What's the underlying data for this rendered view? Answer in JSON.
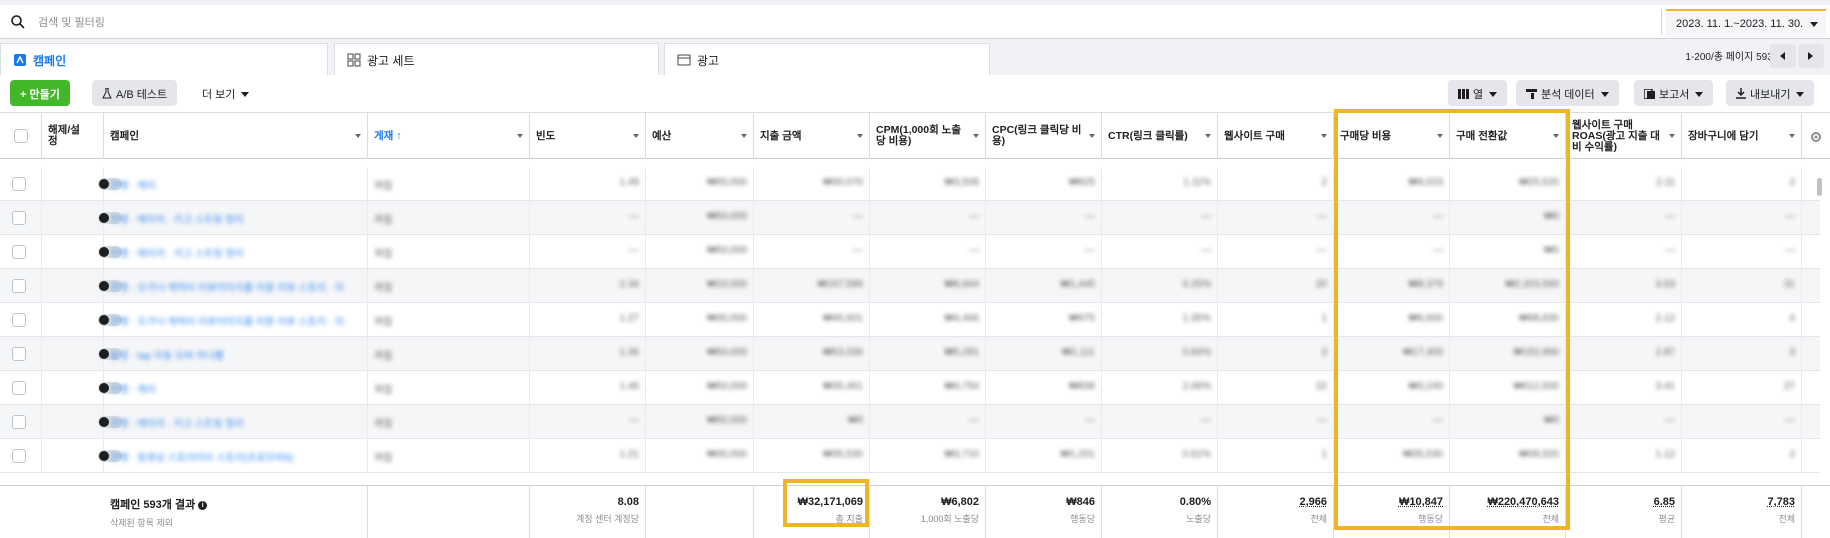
{
  "search": {
    "placeholder": "검색 및 필터링"
  },
  "date_range": "2023. 11. 1.~2023. 11. 30.",
  "tabs": [
    {
      "label": "캠페인"
    },
    {
      "label": "광고 세트"
    },
    {
      "label": "광고"
    }
  ],
  "pager": {
    "text": "1-200/총 페이지 593개"
  },
  "toolbar": {
    "create_label": "+ 만들기",
    "ab_test_label": "A/B 테스트",
    "more_label": "더 보기",
    "columns_label": "열",
    "breakdown_label": "분석 데이터",
    "reports_label": "보고서",
    "export_label": "내보내기"
  },
  "columns": [
    "해제/설정",
    "캠페인",
    "게재 ↑",
    "빈도",
    "예산",
    "지출 금액",
    "CPM(1,000회 노출당 비용)",
    "CPC(링크 클릭당 비용)",
    "CTR(링크 클릭률)",
    "웹사이트 구매",
    "구매당 비용",
    "구매 전환값",
    "웹사이트 구매 ROAS(광고 지출 대비 수익률)",
    "장바구니에 담기"
  ],
  "rows": [
    {
      "name": "진행 · 캐리",
      "delivery": "꺼짐",
      "freq": "1.49",
      "budget": "₩50,000",
      "spend": "₩30,070",
      "cpm": "₩3,508",
      "cpc": "₩825",
      "ctr": "1.11%",
      "purchases": "2",
      "cpp": "₩9,023",
      "value": "₩25,520",
      "roas": "2.11",
      "cart": "2"
    },
    {
      "name": "진행 · 메이저 · 키고 스트링 정리",
      "delivery": "꺼짐",
      "freq": "—",
      "budget": "₩50,000",
      "spend": "—",
      "cpm": "—",
      "cpc": "—",
      "ctr": "—",
      "purchases": "—",
      "cpp": "—",
      "value": "₩0",
      "roas": "—",
      "cart": "—"
    },
    {
      "name": "진행 · 메이저 · 키고 스트링 정리",
      "delivery": "꺼짐",
      "freq": "—",
      "budget": "₩50,000",
      "spend": "—",
      "cpm": "—",
      "cpc": "—",
      "ctr": "—",
      "purchases": "—",
      "cpp": "—",
      "value": "₩0",
      "roas": "—",
      "cart": "—"
    },
    {
      "name": "진행 · 오가닉 캐릭터 리뷰이미지를 이용 리뷰 스토리 · 이",
      "delivery": "꺼짐",
      "freq": "2.34",
      "budget": "₩10,000",
      "spend": "₩167,586",
      "cpm": "₩6,664",
      "cpc": "₩1,445",
      "ctr": "0.25%",
      "purchases": "20",
      "cpp": "₩8,379",
      "value": "₩2,203,560",
      "roas": "3.63",
      "cart": "31"
    },
    {
      "name": "진행 · 오가닉 캐릭터 리뷰이미지를 이용 리뷰 스토리 · 이",
      "delivery": "꺼짐",
      "freq": "1.27",
      "budget": "₩30,000",
      "spend": "₩46,601",
      "cpm": "₩4,466",
      "cpc": "₩675",
      "ctr": "1.35%",
      "purchases": "1",
      "cpp": "₩6,600",
      "value": "₩98,830",
      "roas": "2.12",
      "cart": "4"
    },
    {
      "name": "동영 · tap 이동 오바 하나쁨",
      "delivery": "꺼짐",
      "freq": "1.36",
      "budget": "₩50,000",
      "spend": "₩53,330",
      "cpm": "₩5,281",
      "cpc": "₩1,111",
      "ctr": "0.84%",
      "purchases": "3",
      "cpp": "₩17,400",
      "value": "₩152,960",
      "roas": "2.87",
      "cart": "3"
    },
    {
      "name": "진행 · 캐리",
      "delivery": "꺼짐",
      "freq": "1.46",
      "budget": "₩50,000",
      "spend": "₩35,461",
      "cpm": "₩4,754",
      "cpc": "₩838",
      "ctr": "2.06%",
      "purchases": "22",
      "cpp": "₩3,240",
      "value": "₩612,930",
      "roas": "3.41",
      "cart": "27"
    },
    {
      "name": "진행 · 메이저 · 키고 스트링 정리",
      "delivery": "꺼짐",
      "freq": "—",
      "budget": "₩50,000",
      "spend": "₩0",
      "cpm": "—",
      "cpc": "—",
      "ctr": "—",
      "purchases": "—",
      "cpp": "—",
      "value": "₩0",
      "roas": "—",
      "cart": "—"
    },
    {
      "name": "진행 · 동영상 스토리이브 스토리(프로모바9)",
      "delivery": "꺼짐",
      "freq": "1.21",
      "budget": "₩30,000",
      "spend": "₩35,530",
      "cpm": "₩3,710",
      "cpc": "₩1,201",
      "ctr": "0.61%",
      "purchases": "1",
      "cpp": "₩35,530",
      "value": "₩39,920",
      "roas": "1.12",
      "cart": "2"
    }
  ],
  "footer": {
    "title": "캠페인 593개 결과",
    "subtitle": "삭제된 항목 제외",
    "freq": "8.08",
    "freq_sub": "계정 센터 계정당",
    "spend": "₩32,171,069",
    "spend_sub": "총 지출",
    "cpm": "₩6,802",
    "cpm_sub": "1,000회 노출당",
    "cpc": "₩846",
    "cpc_sub": "행동당",
    "ctr": "0.80%",
    "ctr_sub": "노출당",
    "purchases": "2,966",
    "purchases_sub": "전체",
    "cpp": "₩10,847",
    "cpp_sub": "행동당",
    "value": "₩220,470,643",
    "value_sub": "전체",
    "roas": "6.85",
    "roas_sub": "평균",
    "cart": "7,783",
    "cart_sub": "전체"
  },
  "colors": {
    "accent": "#1877f2",
    "highlight": "#f0b429",
    "create_button": "#42b72a"
  }
}
